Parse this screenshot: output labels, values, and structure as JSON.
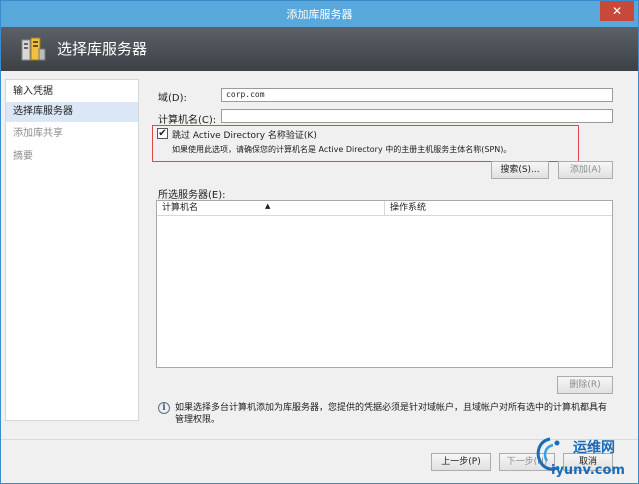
{
  "window": {
    "title": "添加库服务器",
    "close_glyph": "✕"
  },
  "header": {
    "title": "选择库服务器"
  },
  "nav": {
    "items": [
      {
        "label": "输入凭据"
      },
      {
        "label": "选择库服务器"
      },
      {
        "label": "添加库共享"
      },
      {
        "label": "摘要"
      }
    ]
  },
  "form": {
    "domain_label": "域(D):",
    "domain_value": "corp.com",
    "computer_label": "计算机名(C):",
    "computer_value": "",
    "skip_ad_label": "跳过 Active Directory 名称验证(K)",
    "skip_ad_checked": "✔",
    "skip_ad_note": "如果使用此选项，请确保您的计算机名是 Active Directory 中的主册主机服务主体名称(SPN)。",
    "search_button": "搜索(S)...",
    "add_button": "添加(A)"
  },
  "selected_servers": {
    "label": "所选服务器(E):",
    "columns": [
      "计算机名",
      "操作系统"
    ],
    "sort_glyph": "▲",
    "remove_button": "删除(R)"
  },
  "info": {
    "icon": "i",
    "text": "如果选择多台计算机添加为库服务器，您提供的凭据必须是针对域帐户，且域帐户对所有选中的计算机都具有管理权限。"
  },
  "footer": {
    "prev_button": "上一步(P)",
    "next_button": "下一步(N)",
    "cancel_button": "取消"
  },
  "watermark": {
    "cn": "运维网",
    "url": "iyunv.com"
  }
}
